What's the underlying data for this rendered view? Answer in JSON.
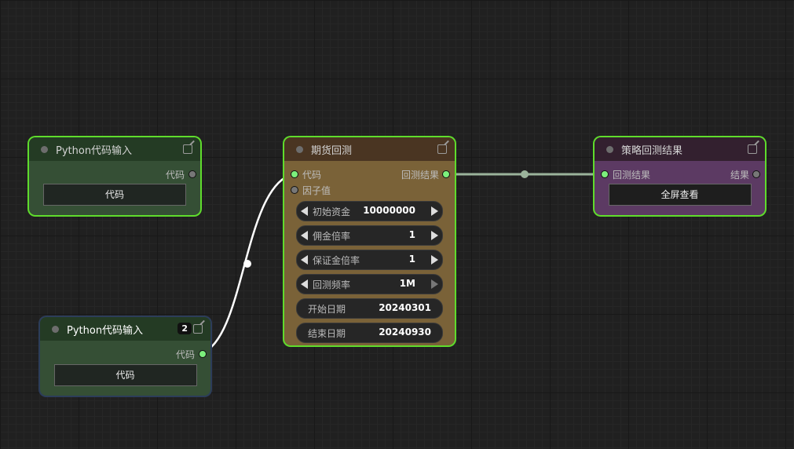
{
  "nodes": {
    "py1": {
      "title": "Python代码输入",
      "out": "代码",
      "btn": "代码"
    },
    "py2": {
      "title": "Python代码输入",
      "badge": "2",
      "out": "代码",
      "btn": "代码"
    },
    "bt": {
      "title": "期货回测",
      "in1": "代码",
      "in2": "因子值",
      "out": "回测结果",
      "widgets": [
        {
          "label": "初始资金",
          "value": "10000000"
        },
        {
          "label": "佣金倍率",
          "value": "1"
        },
        {
          "label": "保证金倍率",
          "value": "1"
        },
        {
          "label": "回测频率",
          "value": "1M"
        },
        {
          "label": "开始日期",
          "value": "20240301"
        },
        {
          "label": "结束日期",
          "value": "20240930"
        }
      ]
    },
    "res": {
      "title": "策略回测结果",
      "in": "回测结果",
      "out": "结果",
      "btn": "全屏查看"
    }
  },
  "colors": {
    "canvas": "#202020",
    "green_node": "#354f35",
    "bt_node": "#7a6238",
    "res_node": "#5c3a63",
    "selected_outline": "#5fdc2c",
    "active_socket": "#7cf07c"
  }
}
